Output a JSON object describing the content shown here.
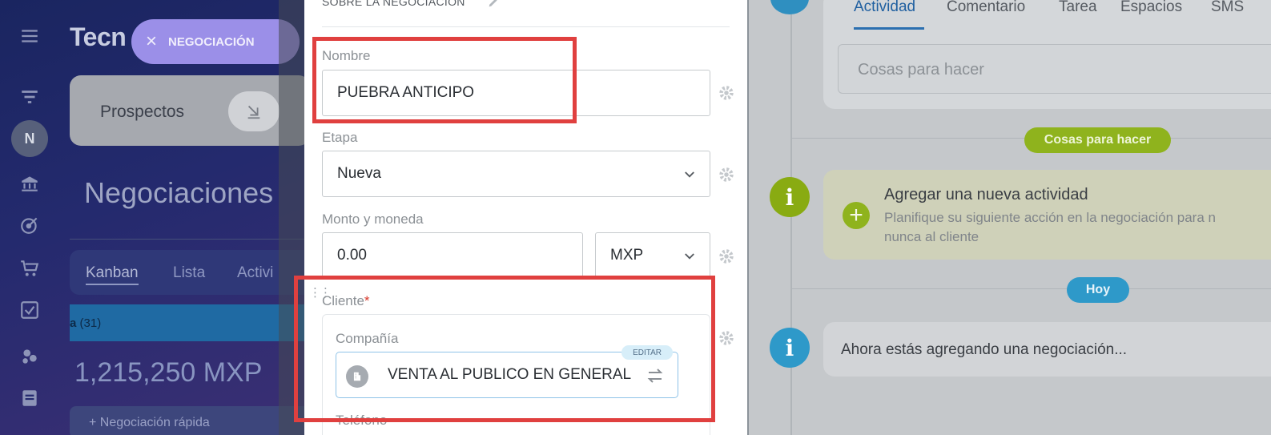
{
  "background_app": {
    "logo": "Tecn",
    "tag_label": "NEGOCIACIÓN",
    "avatar_letter": "N",
    "pipeline_label": "Prospectos",
    "page_heading": "Negociaciones",
    "view_tabs": [
      "Kanban",
      "Lista",
      "Activi"
    ],
    "stage_label_bold": "a",
    "stage_label_count": "(31)",
    "stage_sum": "1,215,250 MXP",
    "quick_deal": "+ Negociación rápida",
    "rail_icons": [
      "menu-icon",
      "filter-icon",
      "bank-icon",
      "target-icon",
      "cart-icon",
      "checkbox-icon",
      "bubbles-icon",
      "document-icon"
    ]
  },
  "modal": {
    "section_header": "SOBRE LA NEGOCIACIÓN",
    "fields": {
      "nombre": {
        "label": "Nombre",
        "value": "PUEBRA ANTICIPO"
      },
      "etapa": {
        "label": "Etapa",
        "value": "Nueva"
      },
      "monto": {
        "label": "Monto y moneda",
        "value": "0.00",
        "currency": "MXP"
      },
      "cliente": {
        "label": "Cliente",
        "required_mark": "*",
        "company_label": "Compañía",
        "company_value": "VENTA AL PUBLICO EN GENERAL",
        "edit_badge": "EDITAR",
        "phone_label": "Teléfono"
      }
    }
  },
  "timeline": {
    "tabs": [
      "Actividad",
      "Comentario",
      "Tarea",
      "Espacios",
      "SMS"
    ],
    "input_placeholder": "Cosas para hacer",
    "pill_todo": "Cosas para hacer",
    "add_card": {
      "title": "Agregar una nueva actividad",
      "description": "Planifique su siguiente acción en la negociación para n\nnunca al cliente"
    },
    "pill_today": "Hoy",
    "now_text": "Ahora estás agregando una negociación..."
  },
  "colors": {
    "annotation": "#e0403f",
    "accent_blue": "#2e99c9",
    "accent_green": "#8fb31d",
    "tag_purple": "#9b8fe8"
  }
}
